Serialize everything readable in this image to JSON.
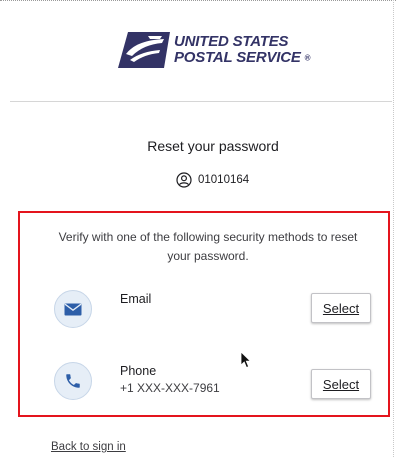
{
  "header": {
    "logo_line1": "UNITED STATES",
    "logo_line2": "POSTAL SERVICE",
    "logo_mark": "®"
  },
  "reset": {
    "title": "Reset your password",
    "username": "01010164",
    "user_icon": "user-circle-icon"
  },
  "methods": {
    "instructions": "Verify with one of the following security methods to reset your password.",
    "items": [
      {
        "label": "Email",
        "detail": "",
        "icon": "envelope-icon",
        "button_label": "Select"
      },
      {
        "label": "Phone",
        "detail": "+1 XXX-XXX-7961",
        "icon": "phone-icon",
        "button_label": "Select"
      }
    ]
  },
  "footer": {
    "back_link": "Back to sign in"
  },
  "colors": {
    "usps_navy": "#333366",
    "highlight_red": "#e4141d",
    "icon_blue": "#2d5ea8",
    "icon_bg": "#e6eef7"
  }
}
